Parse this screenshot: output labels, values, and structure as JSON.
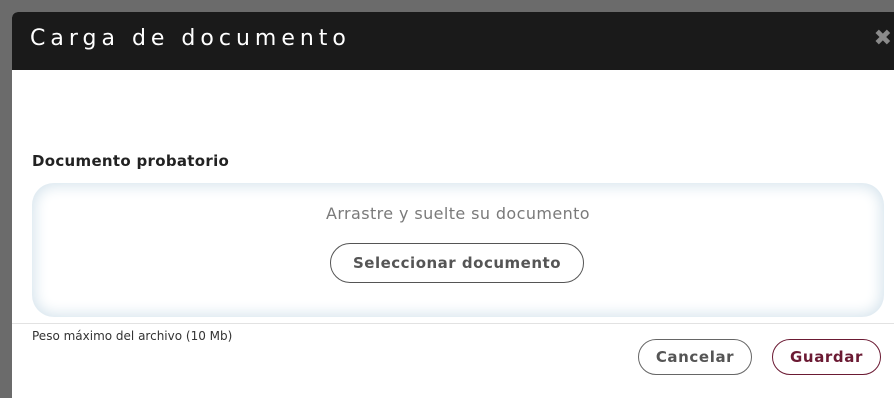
{
  "dialog": {
    "title": "Carga de documento",
    "close_icon": "close-icon"
  },
  "field": {
    "label": "Documento probatorio"
  },
  "dropzone": {
    "prompt": "Arrastre y suelte su documento",
    "select_label": "Seleccionar documento"
  },
  "hint": {
    "max_size": "Peso máximo del archivo (10 Mb)"
  },
  "footer": {
    "cancel_label": "Cancelar",
    "save_label": "Guardar"
  },
  "colors": {
    "header_bg": "#1a1a1a",
    "accent": "#6b1a33"
  }
}
